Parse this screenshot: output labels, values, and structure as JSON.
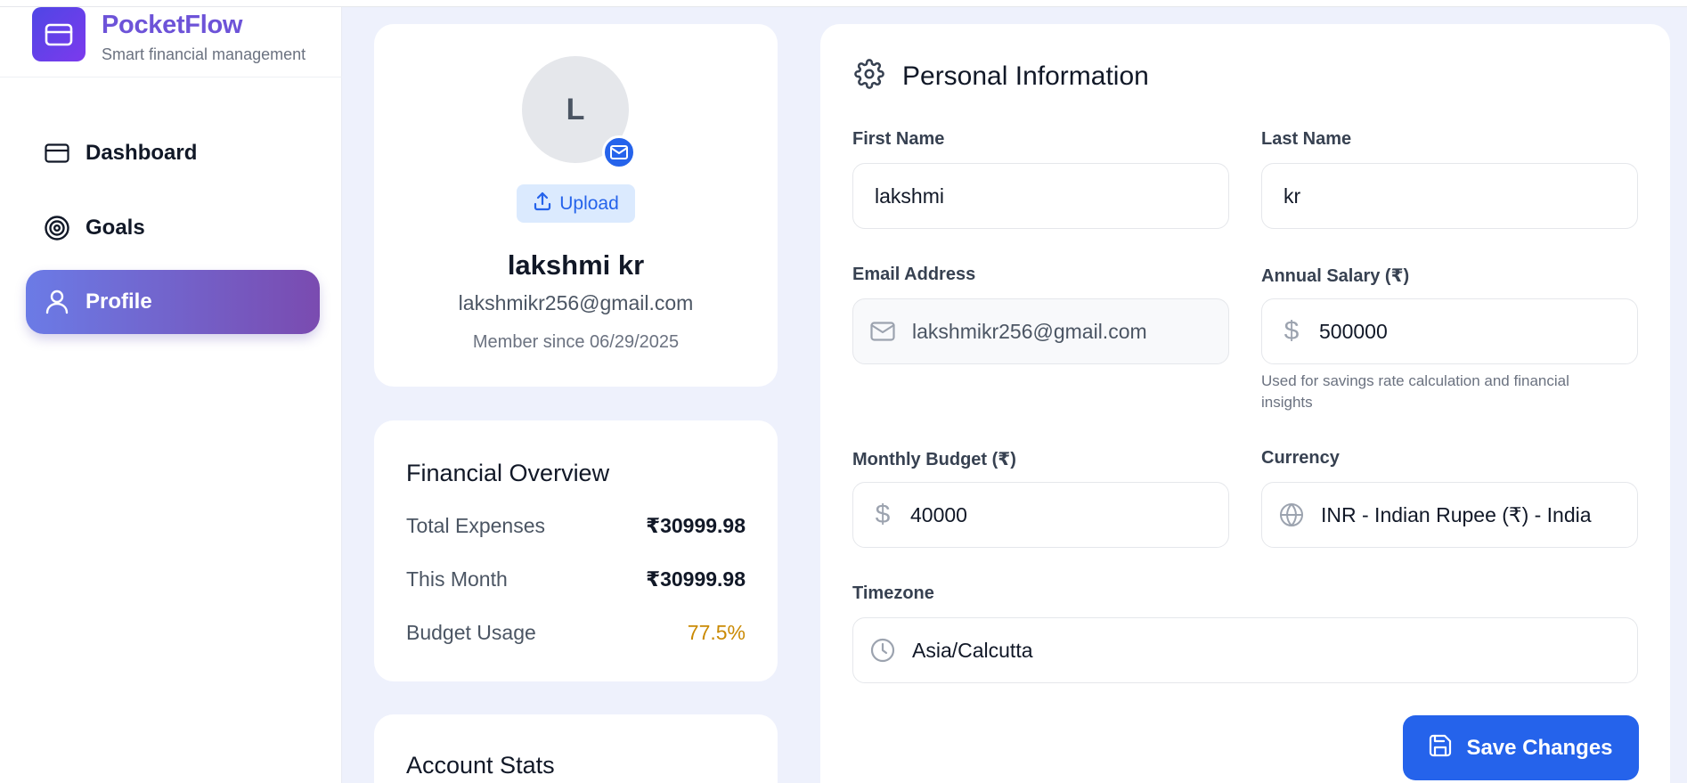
{
  "brand": {
    "name": "PocketFlow",
    "tagline": "Smart financial management"
  },
  "nav": [
    {
      "label": "Dashboard",
      "icon": "credit-card-icon",
      "active": false
    },
    {
      "label": "Goals",
      "icon": "target-icon",
      "active": false
    },
    {
      "label": "Profile",
      "icon": "user-icon",
      "active": true
    }
  ],
  "profile": {
    "initial": "L",
    "upload_label": "Upload",
    "name": "lakshmi kr",
    "email": "lakshmikr256@gmail.com",
    "member_since": "Member since 06/29/2025"
  },
  "overview": {
    "title": "Financial Overview",
    "rows": [
      {
        "label": "Total Expenses",
        "value": "₹30999.98"
      },
      {
        "label": "This Month",
        "value": "₹30999.98"
      },
      {
        "label": "Budget Usage",
        "value": "77.5%"
      }
    ]
  },
  "stats": {
    "title": "Account Stats"
  },
  "personal": {
    "title": "Personal Information",
    "first_name": {
      "label": "First Name",
      "value": "lakshmi"
    },
    "last_name": {
      "label": "Last Name",
      "value": "kr"
    },
    "email": {
      "label": "Email Address",
      "value": "lakshmikr256@gmail.com"
    },
    "salary": {
      "label": "Annual Salary (₹)",
      "value": "500000",
      "helper": "Used for savings rate calculation and financial insights"
    },
    "budget": {
      "label": "Monthly Budget (₹)",
      "value": "40000"
    },
    "currency": {
      "label": "Currency",
      "value": "INR - Indian Rupee (₹) - India"
    },
    "timezone": {
      "label": "Timezone",
      "value": "Asia/Calcutta"
    },
    "save_label": "Save Changes"
  },
  "colors": {
    "primary": "#2563eb",
    "brand": "#6d53d8",
    "warning": "#ca8a04",
    "nav_active_start": "#6b7be6",
    "nav_active_end": "#7a4bb0"
  }
}
